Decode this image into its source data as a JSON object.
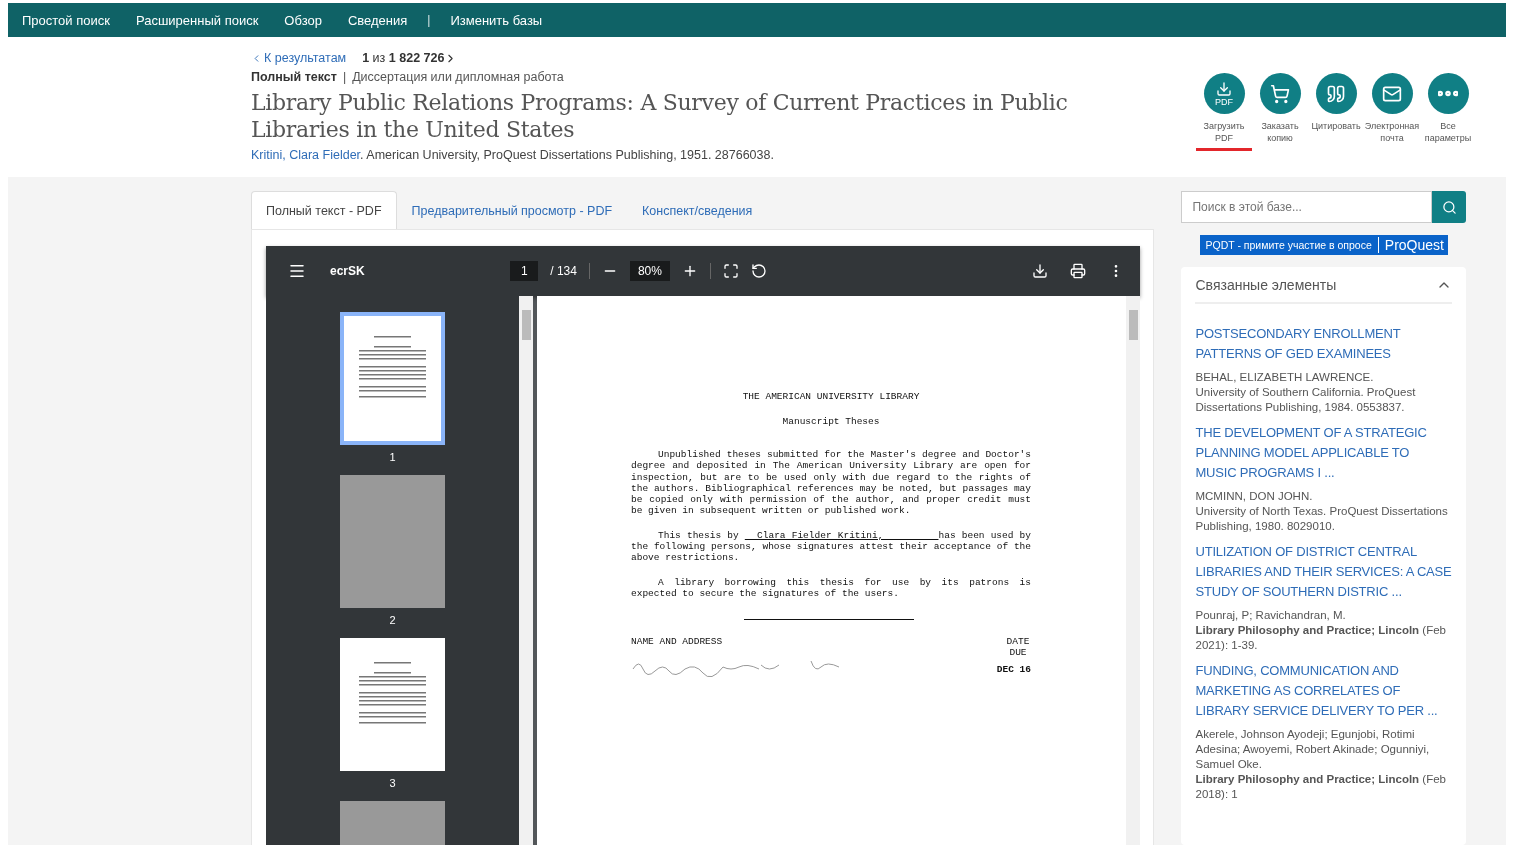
{
  "nav": [
    {
      "kind": "link",
      "label": "Простой поиск"
    },
    {
      "kind": "link",
      "label": "Расширенный поиск"
    },
    {
      "kind": "link",
      "label": "Обзор"
    },
    {
      "kind": "link",
      "label": "Сведения"
    },
    {
      "kind": "separator",
      "label": "|"
    },
    {
      "kind": "link",
      "label": "Изменить базы"
    }
  ],
  "breadcrumb": {
    "back": "К результатам",
    "position": "**1** из **1 822 726**"
  },
  "doc_type": {
    "format": "Полный текст",
    "separator": "|",
    "type": "Диссертация или дипломная работа"
  },
  "title": "Library Public Relations Programs: A Survey of Current Practices in Public Libraries in the United States",
  "citation": {
    "author": "Kritini, Clara Fielder",
    "rest": ". American University, ProQuest Dissertations Publishing, 1951. 28766038."
  },
  "actions": [
    {
      "kind": "download",
      "badge": "PDF",
      "label": "Загрузить PDF",
      "selected": true
    },
    {
      "kind": "cart",
      "label": "Заказать копию",
      "selected": false
    },
    {
      "kind": "quote",
      "label": "Цитировать",
      "selected": false
    },
    {
      "kind": "mail",
      "label": "Электронная почта",
      "selected": false
    },
    {
      "kind": "more",
      "label": "Все параметры",
      "selected": false
    }
  ],
  "tabs": [
    {
      "label": "Полный текст - PDF",
      "selected": true
    },
    {
      "label": "Предварительный просмотр - PDF",
      "selected": false
    },
    {
      "label": "Конспект/сведения",
      "selected": false
    }
  ],
  "viewer": {
    "name": "ecrSK",
    "page": "1",
    "total": "/ 134",
    "zoom": "80%",
    "thumbnails": [
      {
        "kind": "text",
        "label": "1",
        "selected": true
      },
      {
        "kind": "blank",
        "label": "2",
        "selected": false
      },
      {
        "kind": "text",
        "label": "3",
        "selected": false
      },
      {
        "kind": "blank",
        "selected": false
      }
    ],
    "document": {
      "heading": "THE AMERICAN UNIVERSITY LIBRARY",
      "subheading": "Manuscript Theses",
      "paragraph_1": "Unpublished theses submitted for the Master's degree and Doctor's degree and deposited in The American University Library are open for inspection, but are to be used only with due regard to the rights of the authors.  Bibliographical references may be noted, but passages may be copied only with permission of the author, and proper credit must be given in subsequent written or published work.",
      "paragraph_2_start": "This thesis by",
      "paragraph_2_name": "Clara Fielder Kritini,",
      "paragraph_2_end": "has been used by the following persons, whose signatures attest their acceptance of the above restrictions.",
      "paragraph_3": "A library borrowing this thesis for use by its patrons is expected to secure the signatures of the users.",
      "column_1": "NAME AND ADDRESS",
      "column_2": "DATE DUE",
      "stamp": "DEC 16"
    }
  },
  "search": {
    "placeholder": "Поиск в этой базе..."
  },
  "banner": {
    "text": "PQDT - примите участие в опросе",
    "brand": "ProQuest"
  },
  "related": {
    "title": "Связанные элементы",
    "expanded": true,
    "items": [
      {
        "title": "POSTSECONDARY ENROLLMENT PATTERNS OF GED EXAMINEES",
        "lines": [
          "BEHAL, ELIZABETH LAWRENCE.",
          "University of Southern California. ProQuest Dissertations Publishing, 1984. 0553837."
        ]
      },
      {
        "title": "THE DEVELOPMENT OF A STRATEGIC PLANNING MODEL APPLICABLE TO MUSIC PROGRAMS I ...",
        "lines": [
          "MCMINN, DON JOHN.",
          "University of North Texas. ProQuest Dissertations Publishing, 1980. 8029010."
        ]
      },
      {
        "title": "UTILIZATION OF DISTRICT CENTRAL LIBRARIES AND THEIR SERVICES: A CASE STUDY OF SOUTHERN DISTRIC ...",
        "lines": [
          "Pounraj, P; Ravichandran, M.",
          "**Library Philosophy and Practice; Lincoln** (Feb 2021): 1-39."
        ]
      },
      {
        "title": "FUNDING, COMMUNICATION AND MARKETING AS CORRELATES OF LIBRARY SERVICE DELIVERY TO PER ...",
        "lines": [
          "Akerele, Johnson Ayodeji; Egunjobi, Rotimi Adesina; Awoyemi, Robert Akinade; Ogunniyi, Samuel Oke.",
          "**Library Philosophy and Practice; Lincoln** (Feb 2018): 1"
        ]
      }
    ]
  }
}
